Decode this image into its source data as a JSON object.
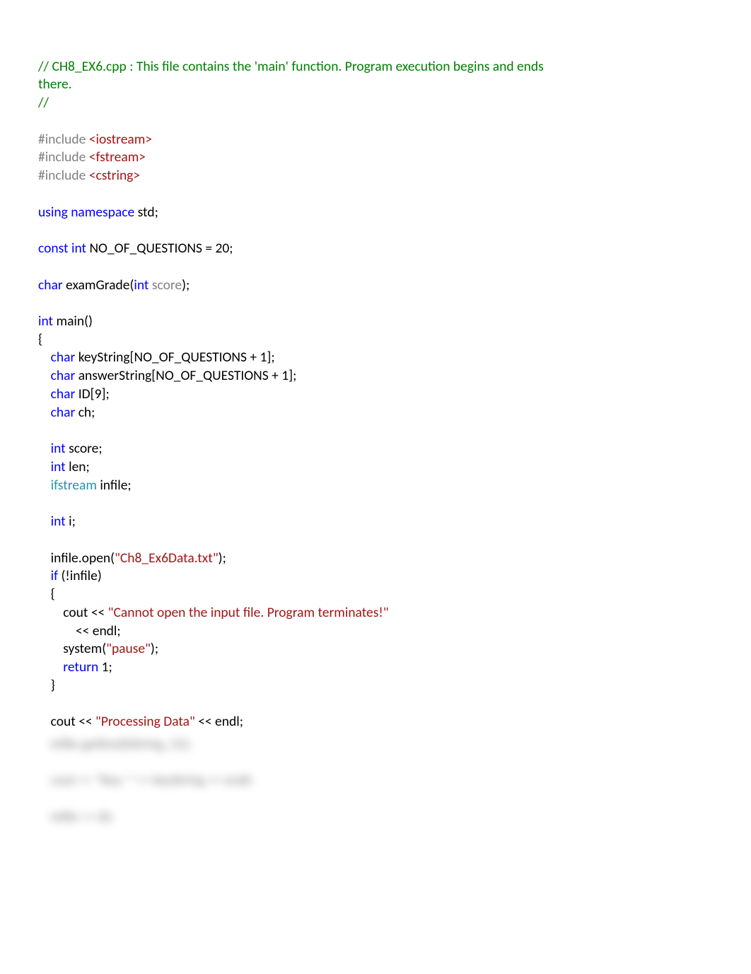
{
  "code": {
    "comment1a": "// CH8_EX6.cpp : This file contains the 'main' function. Program execution begins and ends",
    "comment1b": "there.",
    "comment2": "//",
    "inc_hash": "#include",
    "inc1": " <iostream>",
    "inc2": " <fstream>",
    "inc3": " <cstring>",
    "using1": "using",
    "using2": " namespace",
    "using3": " std;",
    "const1": "const",
    "const2": " int",
    "const3": " NO_OF_QUESTIONS = 20;",
    "fnret": "char",
    "fnname": " examGrade(",
    "fnp1t": "int",
    "fnp1n": " score",
    "fnend": ");",
    "main_t": "int",
    "main_n": " main()",
    "brace_open": "{",
    "d_char": "char",
    "d_keystr": " keyString[NO_OF_QUESTIONS + 1];",
    "d_ansstr": " answerString[NO_OF_QUESTIONS + 1];",
    "d_id": " ID[9];",
    "d_ch": " ch;",
    "d_int": "int",
    "d_score": " score;",
    "d_len": " len;",
    "d_ifstream": "ifstream",
    "d_infile": " infile;",
    "d_i": " i;",
    "open1": "infile.open(",
    "open_str": "\"Ch8_Ex6Data.txt\"",
    "open2": ");",
    "if_kw": "if",
    "if_cond": " (!infile)",
    "cout_obj": "cout << ",
    "err_str": "\"Cannot open the input file. Program terminates!\"",
    "endl_line": "<< endl;",
    "system_call": "system(",
    "pause_str": "\"pause\"",
    "system_end": ");",
    "return_kw": "return",
    "return_val": " 1;",
    "brace_close": "}",
    "proc_str": "\"Processing Data\"",
    "proc_end": " << endl;",
    "ind1": "    ",
    "ind2": "        ",
    "ind3": "            "
  },
  "blurred": {
    "line1": "    infile.getline(kString, 21);",
    "line2": "    cout << \"Key: \" << keyString << endl;",
    "line3": "    infile >> ID;"
  }
}
